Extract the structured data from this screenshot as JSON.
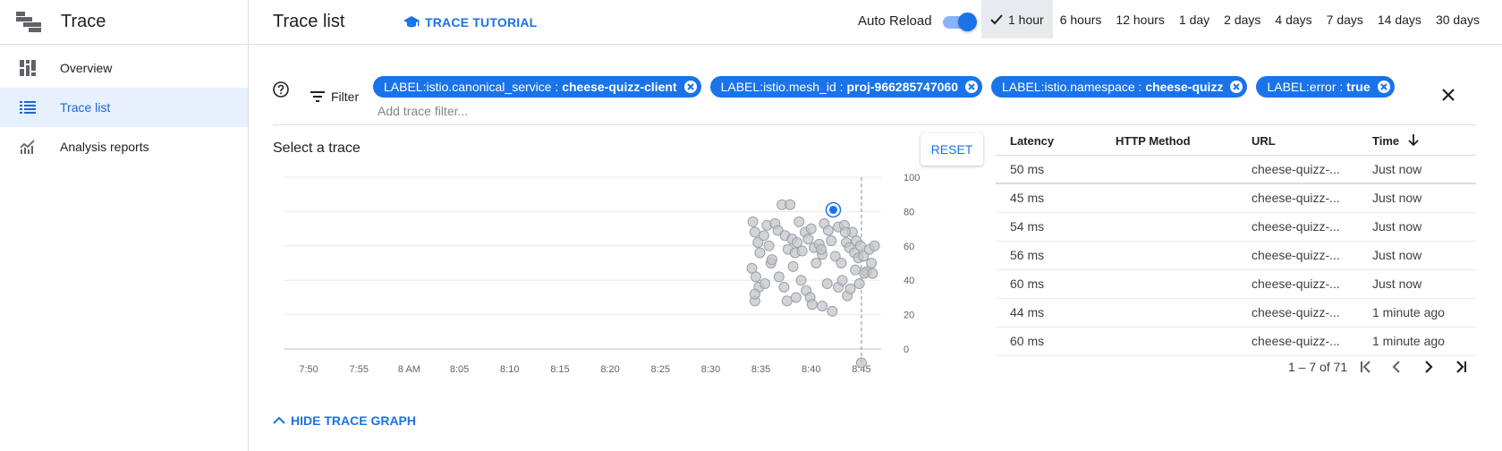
{
  "sidebar": {
    "product_title": "Trace",
    "items": [
      {
        "label": "Overview",
        "icon": "dashboard-icon",
        "active": false
      },
      {
        "label": "Trace list",
        "icon": "list-icon",
        "active": true
      },
      {
        "label": "Analysis reports",
        "icon": "analytics-icon",
        "active": false
      }
    ]
  },
  "header": {
    "page_title": "Trace list",
    "tutorial_label": "TRACE TUTORIAL",
    "auto_reload_label": "Auto Reload",
    "auto_reload_on": true,
    "time_ranges": [
      "1 hour",
      "6 hours",
      "12 hours",
      "1 day",
      "2 days",
      "4 days",
      "7 days",
      "14 days",
      "30 days"
    ],
    "selected_range": "1 hour"
  },
  "filter": {
    "label": "Filter",
    "placeholder": "Add trace filter...",
    "chips": [
      {
        "key": "LABEL:istio.canonical_service : ",
        "value": "cheese-quizz-client"
      },
      {
        "key": "LABEL:istio.mesh_id : ",
        "value": "proj-966285747060"
      },
      {
        "key": "LABEL:istio.namespace : ",
        "value": "cheese-quizz"
      },
      {
        "key": "LABEL:error : ",
        "value": "true"
      }
    ]
  },
  "chart_section": {
    "title": "Select a trace",
    "reset_label": "RESET",
    "hide_label": "HIDE TRACE GRAPH"
  },
  "chart_data": {
    "type": "scatter",
    "x_tick_labels": [
      "7:50",
      "7:55",
      "8 AM",
      "8:05",
      "8:10",
      "8:15",
      "8:20",
      "8:25",
      "8:30",
      "8:35",
      "8:40",
      "8:45"
    ],
    "y_tick_labels": [
      "0",
      "20",
      "40",
      "60",
      "80",
      "100"
    ],
    "xlim_minutes": [
      -57.5,
      2.5
    ],
    "ylim": [
      0,
      100
    ],
    "x_note": "x values are minutes relative to 8:45",
    "selected_point": {
      "x": -2.8,
      "y": 81
    },
    "points": [
      [
        -10.8,
        74
      ],
      [
        -10.6,
        68
      ],
      [
        -10.3,
        62
      ],
      [
        -10.1,
        56
      ],
      [
        -9.7,
        66
      ],
      [
        -9.4,
        72
      ],
      [
        -9.2,
        60
      ],
      [
        -9.0,
        50
      ],
      [
        -8.6,
        73
      ],
      [
        -8.3,
        69
      ],
      [
        -7.9,
        84
      ],
      [
        -7.6,
        66
      ],
      [
        -7.3,
        58
      ],
      [
        -7.1,
        84
      ],
      [
        -6.9,
        64
      ],
      [
        -6.6,
        56
      ],
      [
        -6.4,
        62
      ],
      [
        -6.2,
        74
      ],
      [
        -5.9,
        57
      ],
      [
        -5.6,
        68
      ],
      [
        -5.3,
        64
      ],
      [
        -5.0,
        70
      ],
      [
        -4.7,
        59
      ],
      [
        -4.5,
        50
      ],
      [
        -4.2,
        61
      ],
      [
        -3.9,
        55
      ],
      [
        -3.7,
        73
      ],
      [
        -3.3,
        69
      ],
      [
        -3.0,
        63
      ],
      [
        -2.6,
        54
      ],
      [
        -2.3,
        71
      ],
      [
        -2.0,
        50
      ],
      [
        -1.7,
        72
      ],
      [
        -1.5,
        62
      ],
      [
        -1.2,
        59
      ],
      [
        -0.9,
        68
      ],
      [
        -0.7,
        56
      ],
      [
        -0.5,
        63
      ],
      [
        -0.3,
        53
      ],
      [
        -0.1,
        60
      ],
      [
        0.2,
        54
      ],
      [
        0.5,
        45
      ],
      [
        0.8,
        58
      ],
      [
        1.0,
        50
      ],
      [
        1.3,
        60
      ],
      [
        -10.9,
        47
      ],
      [
        -10.5,
        42
      ],
      [
        -10.2,
        36
      ],
      [
        -10.6,
        28
      ],
      [
        -8.2,
        42
      ],
      [
        -7.7,
        36
      ],
      [
        -7.4,
        28
      ],
      [
        -6.5,
        30
      ],
      [
        -6.0,
        40
      ],
      [
        -5.5,
        34
      ],
      [
        -5.1,
        30
      ],
      [
        -4.9,
        26
      ],
      [
        -3.9,
        25
      ],
      [
        -3.4,
        38
      ],
      [
        -2.9,
        22
      ],
      [
        -2.3,
        36
      ],
      [
        -1.9,
        40
      ],
      [
        -1.4,
        31
      ],
      [
        -1.1,
        35
      ],
      [
        -0.6,
        46
      ],
      [
        -0.2,
        38
      ],
      [
        0.3,
        44
      ],
      [
        1.1,
        44
      ],
      [
        -10.6,
        32
      ],
      [
        -9.6,
        38
      ],
      [
        -8.9,
        52
      ],
      [
        -6.8,
        48
      ],
      [
        -4.0,
        58
      ],
      [
        -1.6,
        68
      ],
      [
        0.0,
        -8
      ]
    ]
  },
  "table": {
    "columns": [
      "Latency",
      "HTTP Method",
      "URL",
      "Time"
    ],
    "rows": [
      [
        "50 ms",
        "",
        "cheese-quizz-...",
        "Just now"
      ],
      [
        "45 ms",
        "",
        "cheese-quizz-...",
        "Just now"
      ],
      [
        "54 ms",
        "",
        "cheese-quizz-...",
        "Just now"
      ],
      [
        "56 ms",
        "",
        "cheese-quizz-...",
        "Just now"
      ],
      [
        "60 ms",
        "",
        "cheese-quizz-...",
        "Just now"
      ],
      [
        "44 ms",
        "",
        "cheese-quizz-...",
        "1 minute ago"
      ],
      [
        "60 ms",
        "",
        "cheese-quizz-...",
        "1 minute ago"
      ]
    ],
    "pagination": "1 – 7 of 71"
  },
  "colors": {
    "accent": "#1a73e8",
    "chip_bg": "#1a73e8",
    "active_nav_bg": "#e8f0fe",
    "point_fill": "#c4c6c9",
    "point_stroke": "#9aa0a6"
  }
}
